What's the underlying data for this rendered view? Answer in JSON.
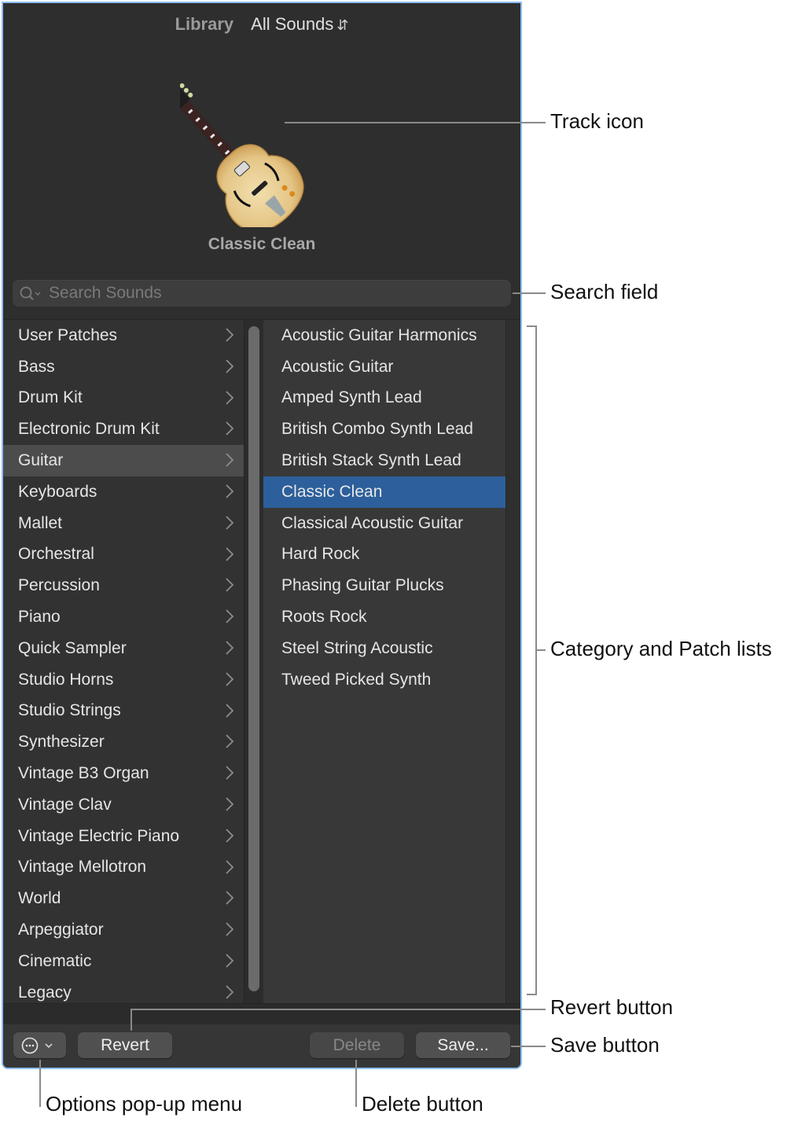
{
  "header": {
    "library_label": "Library",
    "source_selector": "All Sounds",
    "source_selector_icon": "up-down-chevron-icon"
  },
  "track_icon": "electric-archtop-guitar-icon",
  "patch_title": "Classic Clean",
  "search": {
    "placeholder": "Search Sounds",
    "value": "",
    "icon": "magnifier-with-dropdown-icon"
  },
  "categories": [
    {
      "label": "User Patches"
    },
    {
      "label": "Bass"
    },
    {
      "label": "Drum Kit"
    },
    {
      "label": "Electronic Drum Kit"
    },
    {
      "label": "Guitar",
      "selected": true
    },
    {
      "label": "Keyboards"
    },
    {
      "label": "Mallet"
    },
    {
      "label": "Orchestral"
    },
    {
      "label": "Percussion"
    },
    {
      "label": "Piano"
    },
    {
      "label": "Quick Sampler"
    },
    {
      "label": "Studio Horns"
    },
    {
      "label": "Studio Strings"
    },
    {
      "label": "Synthesizer"
    },
    {
      "label": "Vintage B3 Organ"
    },
    {
      "label": "Vintage Clav"
    },
    {
      "label": "Vintage Electric Piano"
    },
    {
      "label": "Vintage Mellotron"
    },
    {
      "label": "World"
    },
    {
      "label": "Arpeggiator"
    },
    {
      "label": "Cinematic"
    },
    {
      "label": "Legacy"
    }
  ],
  "patches": [
    {
      "label": "Acoustic Guitar Harmonics"
    },
    {
      "label": "Acoustic Guitar"
    },
    {
      "label": "Amped Synth Lead"
    },
    {
      "label": "British Combo Synth Lead"
    },
    {
      "label": "British Stack Synth Lead"
    },
    {
      "label": "Classic Clean",
      "selected": true
    },
    {
      "label": "Classical Acoustic Guitar"
    },
    {
      "label": "Hard Rock"
    },
    {
      "label": "Phasing Guitar Plucks"
    },
    {
      "label": "Roots Rock"
    },
    {
      "label": "Steel String Acoustic"
    },
    {
      "label": "Tweed Picked Synth"
    }
  ],
  "toolbar": {
    "options_icon": "ellipsis-circle-icon",
    "revert_label": "Revert",
    "delete_label": "Delete",
    "delete_enabled": false,
    "save_label": "Save..."
  },
  "callouts": {
    "track_icon": "Track icon",
    "search_field": "Search field",
    "lists": "Category and Patch lists",
    "revert": "Revert button",
    "save": "Save button",
    "options": "Options pop-up menu",
    "delete": "Delete button"
  },
  "colors": {
    "selection_blue": "#2c5f9b",
    "category_selected": "#4c4c4c",
    "panel_bg": "#2e2e2e",
    "window_outline": "#8dbef5"
  }
}
